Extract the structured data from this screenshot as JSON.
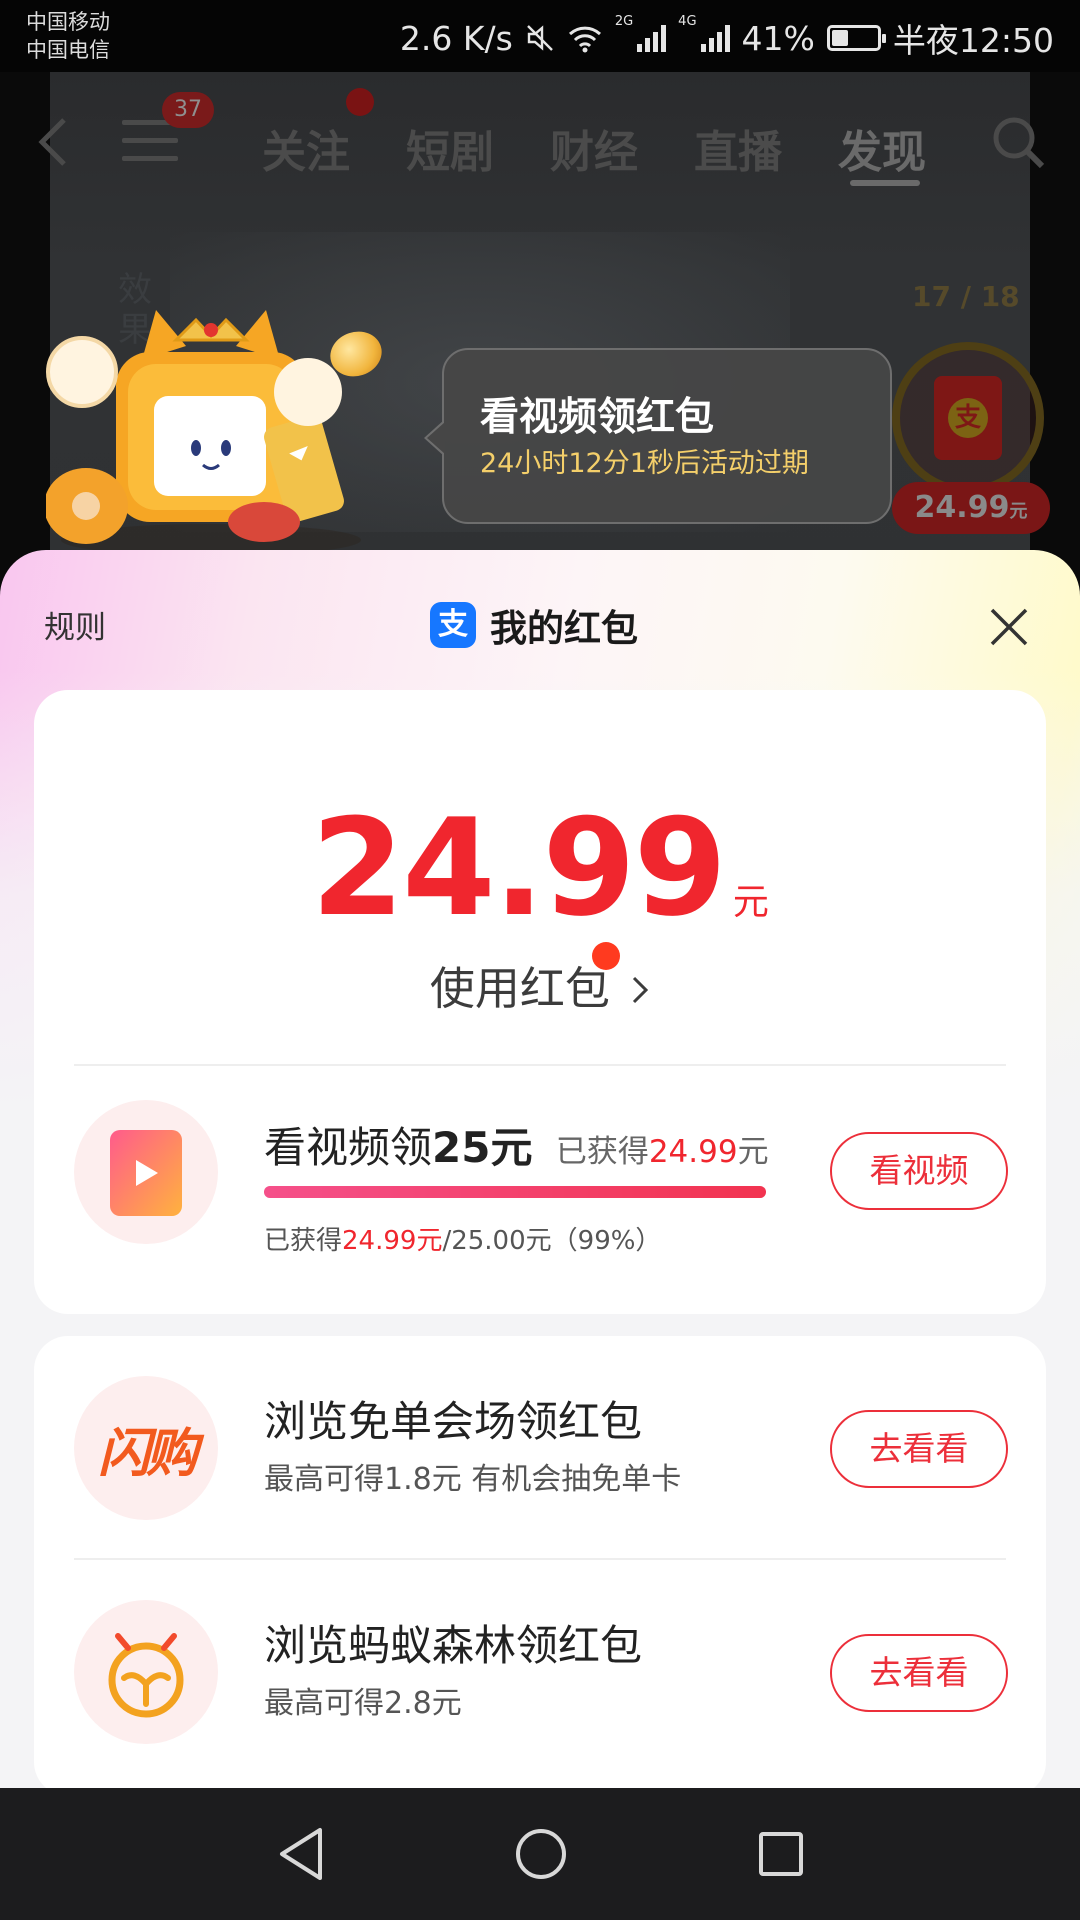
{
  "status_bar": {
    "carrier_1": "中国移动",
    "carrier_2": "中国电信",
    "net_speed": "2.6 K/s",
    "signal_1_tag": "2G",
    "signal_2_tag": "4G",
    "battery_pct": "41%",
    "battery_level": 0.41,
    "time": "半夜12:50"
  },
  "background_video": {
    "menu_badge": "37",
    "tabs": [
      {
        "label": "关注"
      },
      {
        "label": "短剧"
      },
      {
        "label": "财经"
      },
      {
        "label": "直播"
      },
      {
        "label": "发现",
        "active": true
      }
    ],
    "counter": "17 / 18",
    "side_text": "效\n果",
    "side_amount": "24.99",
    "side_amount_unit": "元",
    "side_packet_glyph": "支"
  },
  "tooltip": {
    "title": "看视频领红包",
    "subtitle": "24小时12分1秒后活动过期"
  },
  "sheet": {
    "rules": "规则",
    "logo_glyph": "支",
    "title": "我的红包",
    "balance": {
      "amount": "24.99",
      "unit": "元",
      "use_label": "使用红包"
    },
    "video_task": {
      "title_prefix": "看视频领",
      "title_amount": "25元",
      "earned_prefix": "已获得",
      "earned_amount": "24.99",
      "earned_unit": "元",
      "progress": 0.9996,
      "desc_prefix": "已获得",
      "desc_amount": "24.99元",
      "desc_suffix": "/25.00元（99%）",
      "button": "看视频"
    },
    "tasks": [
      {
        "icon": "shangou-icon",
        "icon_text": "闪购",
        "title": "浏览免单会场领红包",
        "desc": "最高可得1.8元 有机会抽免单卡",
        "button": "去看看"
      },
      {
        "icon": "ant-forest-icon",
        "title": "浏览蚂蚁森林领红包",
        "desc": "最高可得2.8元",
        "button": "去看看"
      }
    ]
  },
  "colors": {
    "accent_red": "#f0262e",
    "alipay_blue": "#1677ff",
    "tooltip_gold": "#f4cf6a"
  }
}
